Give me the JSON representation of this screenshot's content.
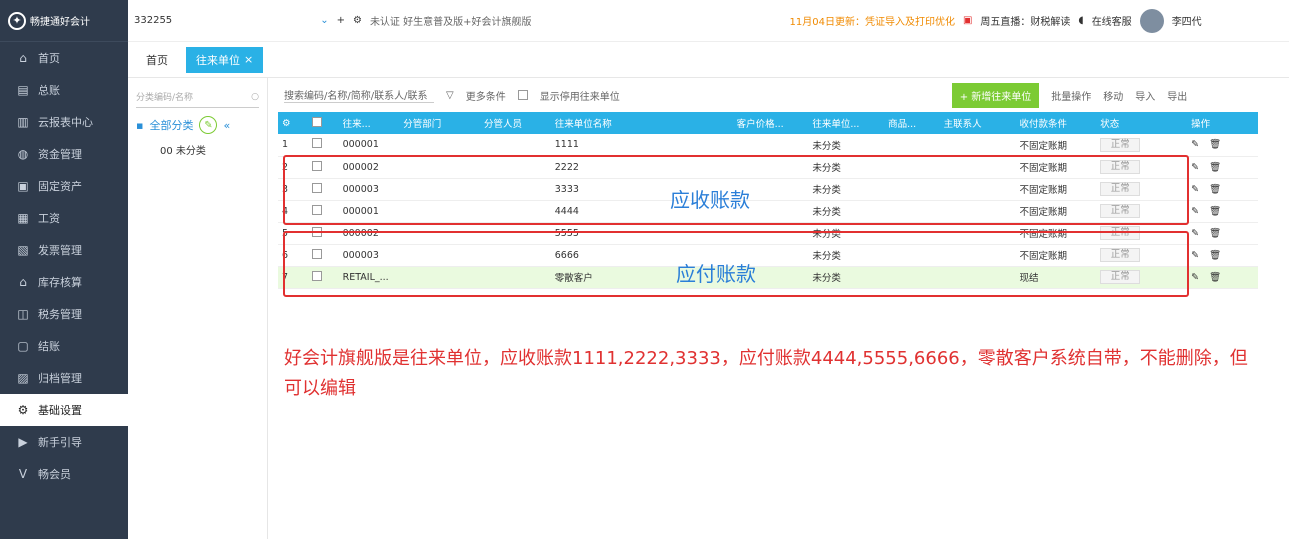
{
  "sidebar": {
    "logo": "畅捷通好会计",
    "items": [
      {
        "icon": "⌂",
        "label": "首页"
      },
      {
        "icon": "▤",
        "label": "总账"
      },
      {
        "icon": "▥",
        "label": "云报表中心"
      },
      {
        "icon": "◍",
        "label": "资金管理"
      },
      {
        "icon": "▣",
        "label": "固定资产"
      },
      {
        "icon": "▦",
        "label": "工资"
      },
      {
        "icon": "▧",
        "label": "发票管理"
      },
      {
        "icon": "⌂",
        "label": "库存核算"
      },
      {
        "icon": "◫",
        "label": "税务管理"
      },
      {
        "icon": "▢",
        "label": "结账"
      },
      {
        "icon": "▨",
        "label": "归档管理"
      },
      {
        "icon": "⚙",
        "label": "基础设置"
      },
      {
        "icon": "▶",
        "label": "新手引导"
      },
      {
        "icon": "V",
        "label": "畅会员"
      }
    ]
  },
  "topbar": {
    "account": "332255",
    "notice": "未认证 好生意普及版+好会计旗舰版",
    "news": "11月04日更新：凭证导入及打印优化",
    "live": "周五直播：财税解读",
    "service": "在线客服",
    "user": "李四代"
  },
  "tabs": {
    "home": "首页",
    "active": "往来单位"
  },
  "left": {
    "search_placeholder": "分类编码/名称",
    "root": "全部分类",
    "uncategorized": "00 未分类"
  },
  "toolbar": {
    "search_placeholder": "搜索编码/名称/简称/联系人/联系",
    "more": "更多条件",
    "show_disabled": "显示停用往来单位",
    "add": "+ 新增往来单位",
    "batch": "批量操作",
    "move": "移动",
    "import": "导入",
    "export": "导出"
  },
  "table": {
    "headers": [
      "往来...",
      "分管部门",
      "分管人员",
      "往来单位名称",
      "客户价格...",
      "往来单位...",
      "商品...",
      "主联系人",
      "收付款条件",
      "状态",
      "操作"
    ],
    "rows": [
      {
        "no": "1",
        "code": "000001",
        "name": "1111",
        "category": "未分类",
        "terms": "不固定账期",
        "status": "正常"
      },
      {
        "no": "2",
        "code": "000002",
        "name": "2222",
        "category": "未分类",
        "terms": "不固定账期",
        "status": "正常"
      },
      {
        "no": "3",
        "code": "000003",
        "name": "3333",
        "category": "未分类",
        "terms": "不固定账期",
        "status": "正常"
      },
      {
        "no": "4",
        "code": "000001",
        "name": "4444",
        "category": "未分类",
        "terms": "不固定账期",
        "status": "正常"
      },
      {
        "no": "5",
        "code": "000002",
        "name": "5555",
        "category": "未分类",
        "terms": "不固定账期",
        "status": "正常"
      },
      {
        "no": "6",
        "code": "000003",
        "name": "6666",
        "category": "未分类",
        "terms": "不固定账期",
        "status": "正常"
      },
      {
        "no": "7",
        "code": "RETAIL_...",
        "name": "零散客户",
        "category": "未分类",
        "terms": "现结",
        "status": "正常"
      }
    ]
  },
  "annotations": {
    "receivable": "应收账款",
    "payable": "应付账款",
    "note": "好会计旗舰版是往来单位，应收账款1111,2222,3333，应付账款4444,5555,6666，零散客户系统自带，不能删除，但可以编辑"
  },
  "colors": {
    "accent": "#2ab1e6",
    "sidebar": "#2f3b4c",
    "green": "#7ccb34",
    "red": "#e23030"
  }
}
